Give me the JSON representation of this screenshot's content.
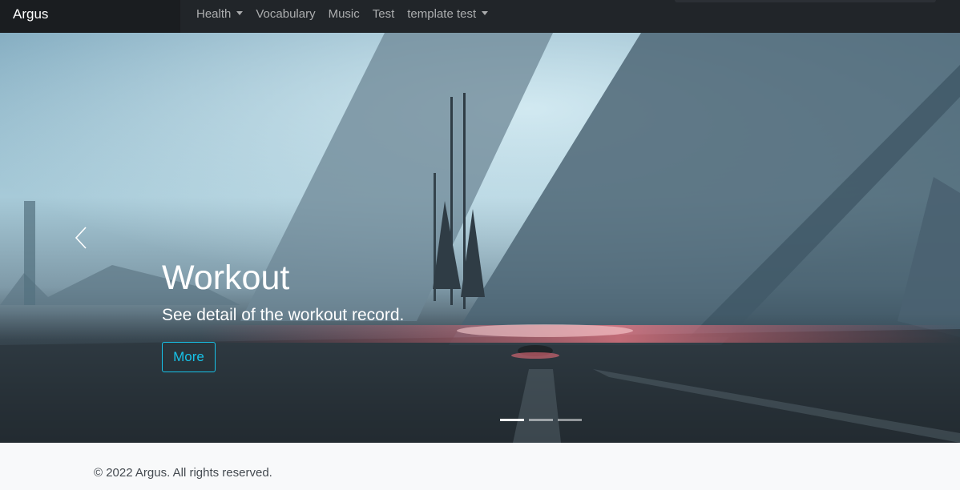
{
  "navbar": {
    "brand": "Argus",
    "items": [
      {
        "label": "Health",
        "dropdown": true
      },
      {
        "label": "Vocabulary",
        "dropdown": false
      },
      {
        "label": "Music",
        "dropdown": false
      },
      {
        "label": "Test",
        "dropdown": false
      },
      {
        "label": "template test",
        "dropdown": true
      }
    ]
  },
  "carousel": {
    "prev_icon": "chevron-left-icon",
    "active_slide": 1,
    "slide_count": 3,
    "caption": {
      "title": "Workout",
      "text": "See detail of the workout record.",
      "button": "More"
    }
  },
  "footer": {
    "copyright": "© 2022 Argus. All rights reserved."
  },
  "colors": {
    "navbar_bg": "#212529",
    "brand_bg": "#1a1d20",
    "accent": "#17c2e8",
    "footer_bg": "#f8f9fa"
  }
}
